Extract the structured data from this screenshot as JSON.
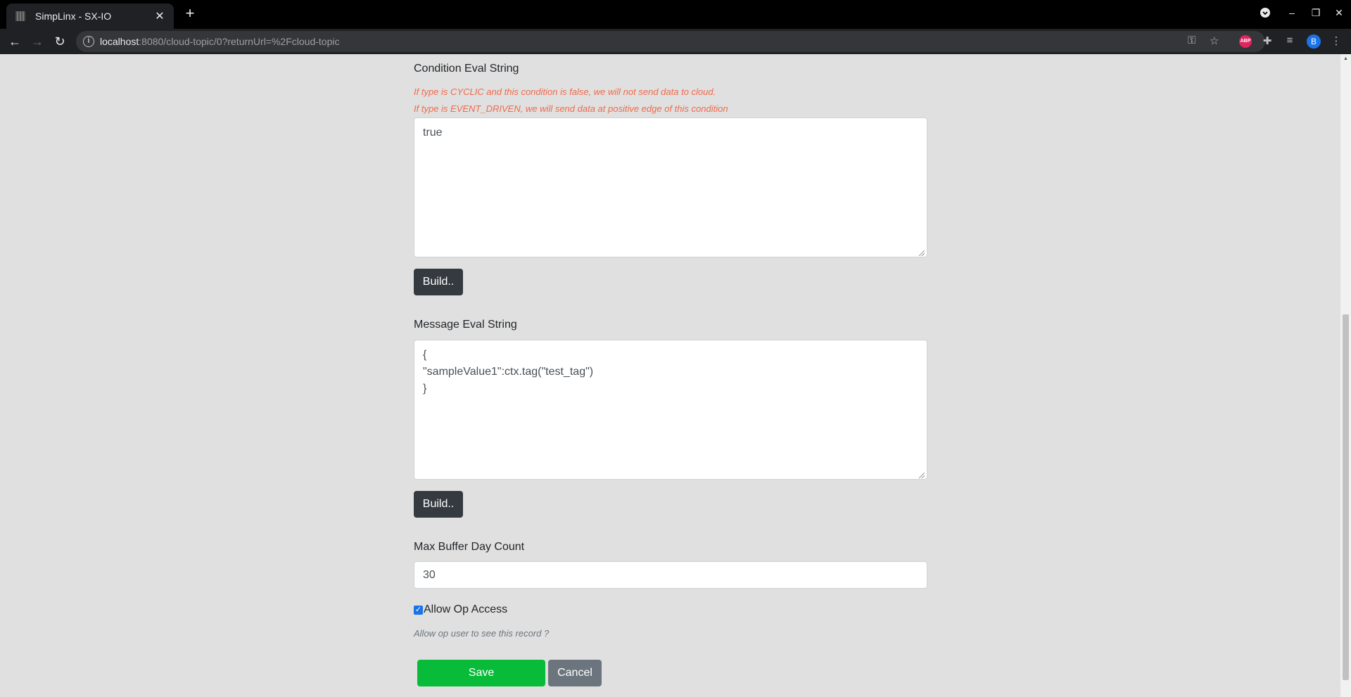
{
  "browser": {
    "tab_title": "SimpLinx - SX-IO",
    "url_host": "localhost",
    "url_rest": ":8080/cloud-topic/0?returnUrl=%2Fcloud-topic",
    "extension_abp": "ABP",
    "profile_initial": "B"
  },
  "form": {
    "condition": {
      "label": "Condition Eval String",
      "hint_cyclic": "If type is CYCLIC and this condition is false, we will not send data to cloud.",
      "hint_event": "If type is EVENT_DRIVEN, we will send data at positive edge of this condition",
      "value": "true",
      "build_label": "Build.."
    },
    "message": {
      "label": "Message Eval String",
      "value": "{\n\"sampleValue1\":ctx.tag(\"test_tag\")\n}",
      "build_label": "Build.."
    },
    "buffer": {
      "label": "Max Buffer Day Count",
      "value": "30"
    },
    "op_access": {
      "label": "Allow Op Access",
      "checked": true,
      "hint": "Allow op user to see this record ?"
    },
    "save_label": "Save",
    "cancel_label": "Cancel"
  },
  "colors": {
    "hint": "#f06a4b",
    "save": "#08bb39",
    "build": "#343a40",
    "cancel": "#6c757d"
  }
}
